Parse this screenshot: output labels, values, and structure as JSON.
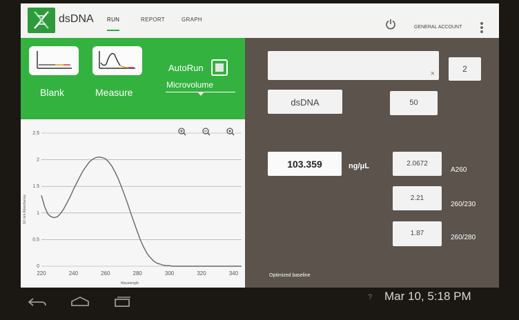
{
  "header": {
    "app_title": "dsDNA",
    "tabs": [
      "RUN",
      "REPORT",
      "GRAPH"
    ],
    "account": "GENERAL ACCOUNT"
  },
  "controls": {
    "blank_label": "Blank",
    "measure_label": "Measure",
    "autorun_label": "AutoRun",
    "volume_mode": "Microvolume"
  },
  "sample": {
    "name_value": "",
    "count": "2",
    "type": "dsDNA",
    "factor": "50"
  },
  "results": {
    "concentration": "103.359",
    "unit": "ng/μL",
    "a260": "2.0672",
    "a260_label": "A260",
    "ratio_260_230": "2.21",
    "ratio_260_230_label": "260/230",
    "ratio_260_280": "1.87",
    "ratio_260_280_label": "260/280",
    "baseline": "Optimized baseline"
  },
  "chart_data": {
    "type": "line",
    "title": "",
    "xlabel": "Wavelength",
    "ylabel": "10 mm Absorbance",
    "xlim": [
      220,
      345
    ],
    "ylim": [
      0,
      2.5
    ],
    "x_ticks": [
      "220",
      "240",
      "260",
      "280",
      "300",
      "320",
      "340"
    ],
    "y_ticks": [
      "0",
      "0.5",
      "1",
      "1.5",
      "2",
      "2.5"
    ],
    "grid": true,
    "series": [
      {
        "x": [
          220,
          222,
          224,
          226,
          228,
          230,
          232,
          234,
          236,
          238,
          240,
          242,
          244,
          246,
          248,
          250,
          252,
          254,
          256,
          258,
          260,
          262,
          264,
          266,
          268,
          270,
          272,
          274,
          276,
          278,
          280,
          282,
          284,
          286,
          288,
          290,
          292,
          294,
          296,
          298,
          300,
          302,
          304,
          306,
          308,
          310,
          315,
          320,
          330,
          340,
          345
        ],
        "y": [
          1.33,
          1.12,
          0.98,
          0.93,
          0.91,
          0.93,
          0.99,
          1.08,
          1.19,
          1.31,
          1.44,
          1.56,
          1.68,
          1.79,
          1.88,
          1.96,
          2.01,
          2.04,
          2.05,
          2.04,
          2.02,
          1.96,
          1.88,
          1.77,
          1.64,
          1.49,
          1.33,
          1.16,
          0.98,
          0.81,
          0.64,
          0.48,
          0.35,
          0.24,
          0.16,
          0.1,
          0.06,
          0.04,
          0.02,
          0.01,
          0.01,
          0.0,
          0.0,
          0.0,
          0.0,
          0.0,
          0.0,
          0.0,
          0.0,
          0.0,
          0.0
        ],
        "color": "#666666"
      }
    ]
  },
  "status": {
    "datetime": "Mar 10, 5:18 PM",
    "help": "?"
  },
  "colors": {
    "accent": "#34b23f",
    "panel": "#5b534c",
    "field": "#f2f2f2"
  },
  "icons": [
    "dna-logo-icon",
    "power-icon",
    "more-vert-icon",
    "blank-spectrum-icon",
    "measure-spectrum-icon",
    "zoom-in-icon",
    "zoom-out-icon",
    "zoom-reset-icon",
    "clear-icon",
    "back-icon",
    "home-icon",
    "recents-icon"
  ]
}
